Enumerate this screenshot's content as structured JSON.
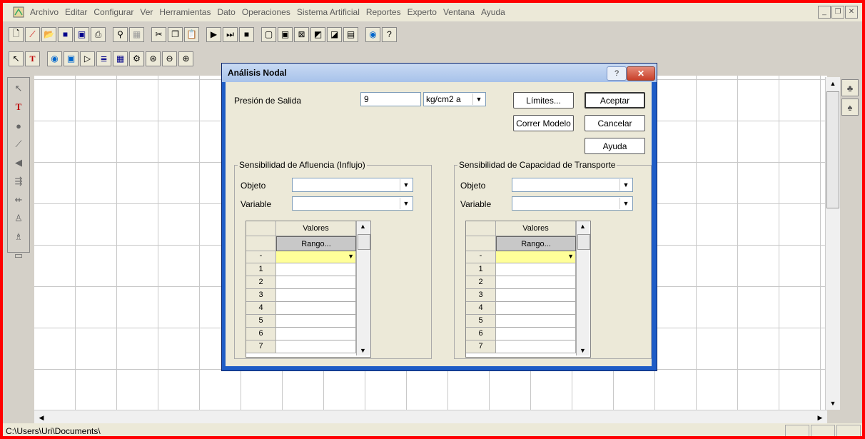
{
  "menubar": {
    "items": [
      "Archivo",
      "Editar",
      "Configurar",
      "Ver",
      "Herramientas",
      "Dato",
      "Operaciones",
      "Sistema Artificial",
      "Reportes",
      "Experto",
      "Ventana",
      "Ayuda"
    ]
  },
  "toolbar1": {
    "buttons": [
      "new-icon",
      "line-icon",
      "open-icon",
      "save-icon",
      "save-as-icon",
      "print-icon",
      "find-icon",
      "grid-icon",
      "cut-icon",
      "copy-icon",
      "paste-icon",
      "play-icon",
      "step-icon",
      "stop-icon",
      "view1-icon",
      "view2-icon",
      "view3-icon",
      "view4-icon",
      "view5-icon",
      "table-icon",
      "globe-icon",
      "help-icon"
    ]
  },
  "toolbar2": {
    "buttons": [
      "pointer-icon",
      "text-icon",
      "source-icon",
      "well-icon",
      "valve-icon",
      "separator-icon",
      "tank-icon",
      "pump-icon",
      "compressor-icon",
      "choke-icon",
      "node-icon"
    ]
  },
  "dialog": {
    "title": "Análisis Nodal",
    "help_btn": "?",
    "close_btn": "✕",
    "pressure_label": "Presión de Salida",
    "pressure_value": "9",
    "pressure_unit": "kg/cm2 a",
    "buttons": {
      "limits": "Límites...",
      "accept": "Aceptar",
      "run_model": "Correr Modelo",
      "cancel": "Cancelar",
      "help": "Ayuda"
    },
    "inflow": {
      "title": "Sensibilidad de Afluencia (Influjo)",
      "object_label": "Objeto",
      "variable_label": "Variable",
      "grid_header": "Valores",
      "range_btn": "Rango...",
      "first_row": "-",
      "rows": [
        "1",
        "2",
        "3",
        "4",
        "5",
        "6",
        "7"
      ]
    },
    "outflow": {
      "title": "Sensibilidad de Capacidad de Transporte",
      "object_label": "Objeto",
      "variable_label": "Variable",
      "grid_header": "Valores",
      "range_btn": "Rango...",
      "first_row": "-",
      "rows": [
        "1",
        "2",
        "3",
        "4",
        "5",
        "6",
        "7"
      ]
    }
  },
  "statusbar": {
    "path": "C:\\Users\\Uri\\Documents\\"
  },
  "colors": {
    "frame_border": "#ff0000",
    "dialog_border": "#1e5cc6",
    "highlight_cell": "#ffff99"
  }
}
